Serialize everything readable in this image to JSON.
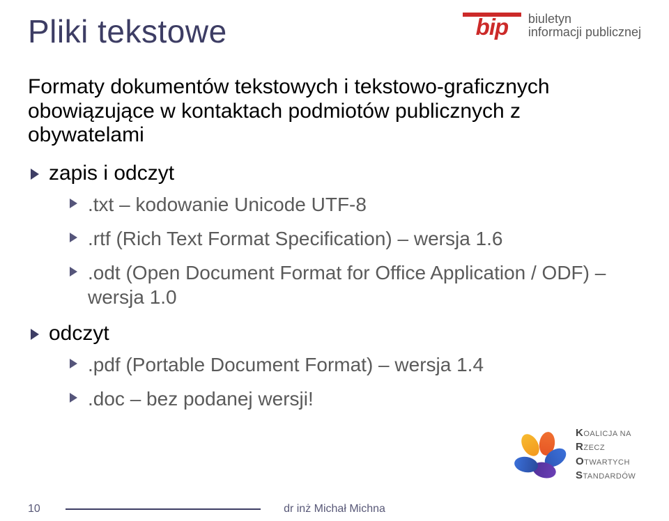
{
  "header": {
    "title": "Pliki tekstowe",
    "bip_mark": "bip",
    "bip_line1": "biuletyn",
    "bip_line2": "informacji publicznej"
  },
  "lead": "Formaty dokumentów tekstowych i tekstowo-graficznych obowiązujące w kontaktach podmiotów publicznych z obywatelami",
  "list": {
    "item1": {
      "label": "zapis i odczyt",
      "sub1": ".txt – kodowanie Unicode UTF-8",
      "sub2": ".rtf (Rich Text Format Specification) – wersja 1.6",
      "sub3": ".odt (Open Document Format for Office Application / ODF) – wersja 1.0"
    },
    "item2": {
      "label": "odczyt",
      "sub1": ".pdf (Portable Document Format) – wersja 1.4",
      "sub2": ".doc – bez podanej wersji!"
    }
  },
  "koalicja": {
    "l1_pre": "K",
    "l1_rest": "OALICJA NA",
    "l2_pre": "R",
    "l2_rest": "ZECZ",
    "l3_pre": "O",
    "l3_rest": "TWARTYCH",
    "l4_pre": "S",
    "l4_rest": "TANDARDÓW"
  },
  "footer": {
    "page": "10",
    "author": "dr inż Michał Michna"
  }
}
